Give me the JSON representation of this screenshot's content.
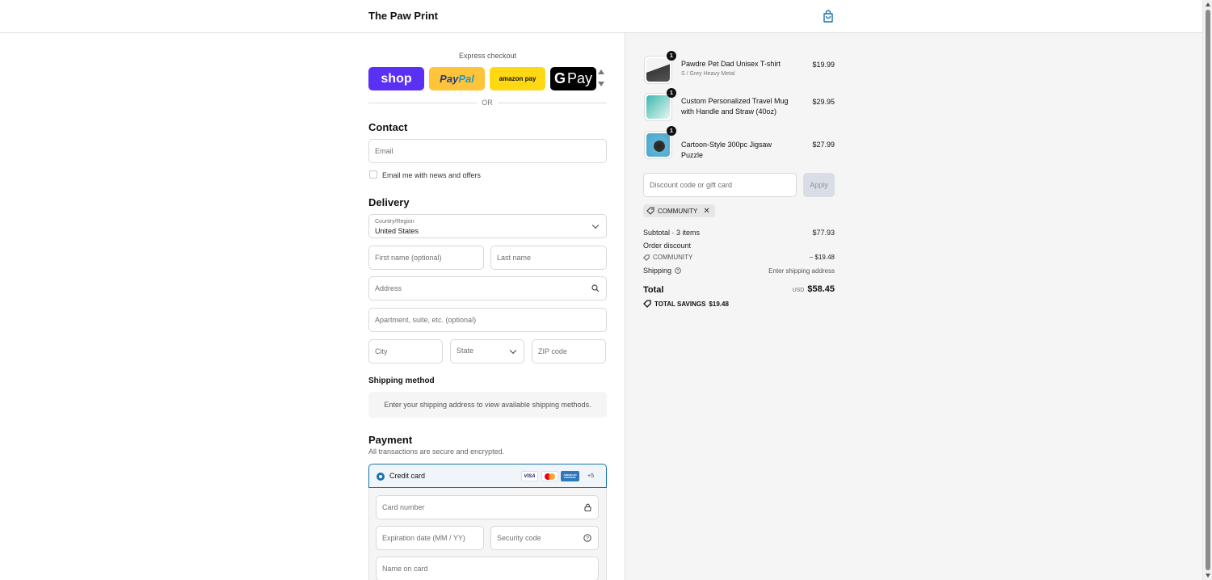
{
  "header": {
    "brand": "The Paw Print",
    "cart_icon": "shopping-bag-icon"
  },
  "express": {
    "title": "Express checkout",
    "buttons": {
      "shop": "shop",
      "paypal_a": "Pay",
      "paypal_b": "Pal",
      "amazon": "amazon pay",
      "gpay_g": "G",
      "gpay": "Pay"
    },
    "or": "OR"
  },
  "contact": {
    "title": "Contact",
    "email_placeholder": "Email",
    "newsletter_label": "Email me with news and offers"
  },
  "delivery": {
    "title": "Delivery",
    "country_label": "Country/Region",
    "country_value": "United States",
    "first_name": "First name (optional)",
    "last_name": "Last name",
    "address": "Address",
    "apartment": "Apartment, suite, etc. (optional)",
    "city": "City",
    "state": "State",
    "zip": "ZIP code"
  },
  "shipping_method": {
    "title": "Shipping method",
    "message": "Enter your shipping address to view available shipping methods."
  },
  "payment": {
    "title": "Payment",
    "note": "All transactions are secure and encrypted.",
    "method": "Credit card",
    "brands": {
      "visa": "VISA",
      "amex": "AMERICAN EXPRESS",
      "more": "+5"
    },
    "card_number": "Card number",
    "expiration": "Expiration date (MM / YY)",
    "security": "Security code",
    "name": "Name on card"
  },
  "order": {
    "items": [
      {
        "name": "Pawdre Pet Dad Unisex T-shirt",
        "variant": "S / Grey Heavy Metal",
        "price": "$19.99",
        "qty": "1"
      },
      {
        "name": "Custom Personalized Travel Mug with Handle and Straw (40oz)",
        "variant": "",
        "price": "$29.95",
        "qty": "1"
      },
      {
        "name": "Cartoon-Style 300pc Jigsaw Puzzle",
        "variant": "",
        "price": "$27.99",
        "qty": "1"
      }
    ],
    "discount_placeholder": "Discount code or gift card",
    "apply": "Apply",
    "applied_code": "COMMUNITY",
    "subtotal_label": "Subtotal · 3 items",
    "subtotal_value": "$77.93",
    "order_discount_label": "Order discount",
    "discount_code": "COMMUNITY",
    "discount_value": "− $19.48",
    "shipping_label": "Shipping",
    "shipping_value": "Enter shipping address",
    "total_label": "Total",
    "currency": "USD",
    "total_value": "$58.45",
    "savings_label": "TOTAL SAVINGS",
    "savings_value": "$19.48"
  },
  "colors": {
    "accent": "#1773b0",
    "shop": "#5a31f4",
    "paypal": "#ffc439",
    "amazon": "#ffd814"
  }
}
